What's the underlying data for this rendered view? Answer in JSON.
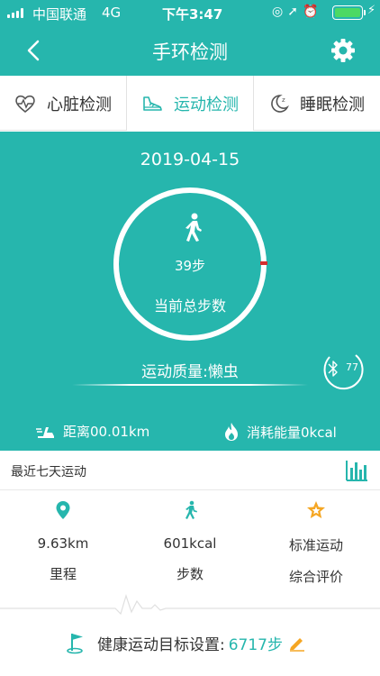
{
  "status_bar": {
    "carrier": "中国联通",
    "network": "4G",
    "time": "下午3:47",
    "battery_color": "#4cd964"
  },
  "nav": {
    "title": "手环检测",
    "back_icon": "chevron-left-icon",
    "settings_icon": "gear-icon"
  },
  "tabs": [
    {
      "label": "心脏检测",
      "icon": "heart-pulse-icon",
      "active": false
    },
    {
      "label": "运动检测",
      "icon": "shoe-icon",
      "active": true
    },
    {
      "label": "睡眠检测",
      "icon": "moon-icon",
      "active": false
    }
  ],
  "hero": {
    "date": "2019-04-15",
    "steps": "39步",
    "steps_label": "当前总步数",
    "quality": "运动质量:懒虫",
    "bluetooth_value": "77",
    "distance": "距离00.01km",
    "energy": "消耗能量0kcal"
  },
  "week": {
    "label": "最近七天运动",
    "chart_icon": "bar-chart-icon"
  },
  "metrics": [
    {
      "value": "9.63km",
      "name": "里程",
      "icon": "location-pin-icon"
    },
    {
      "value": "601kcal",
      "name": "步数",
      "icon": "runner-icon"
    },
    {
      "value": "标准运动",
      "name": "综合评价",
      "icon": "star-badge-icon"
    }
  ],
  "goal": {
    "label": "健康运动目标设置:",
    "value": "6717步",
    "icon": "flag-icon",
    "edit_icon": "pencil-icon"
  },
  "colors": {
    "accent": "#26b6ad",
    "marker": "#d32f2f",
    "star": "#f5a623"
  }
}
